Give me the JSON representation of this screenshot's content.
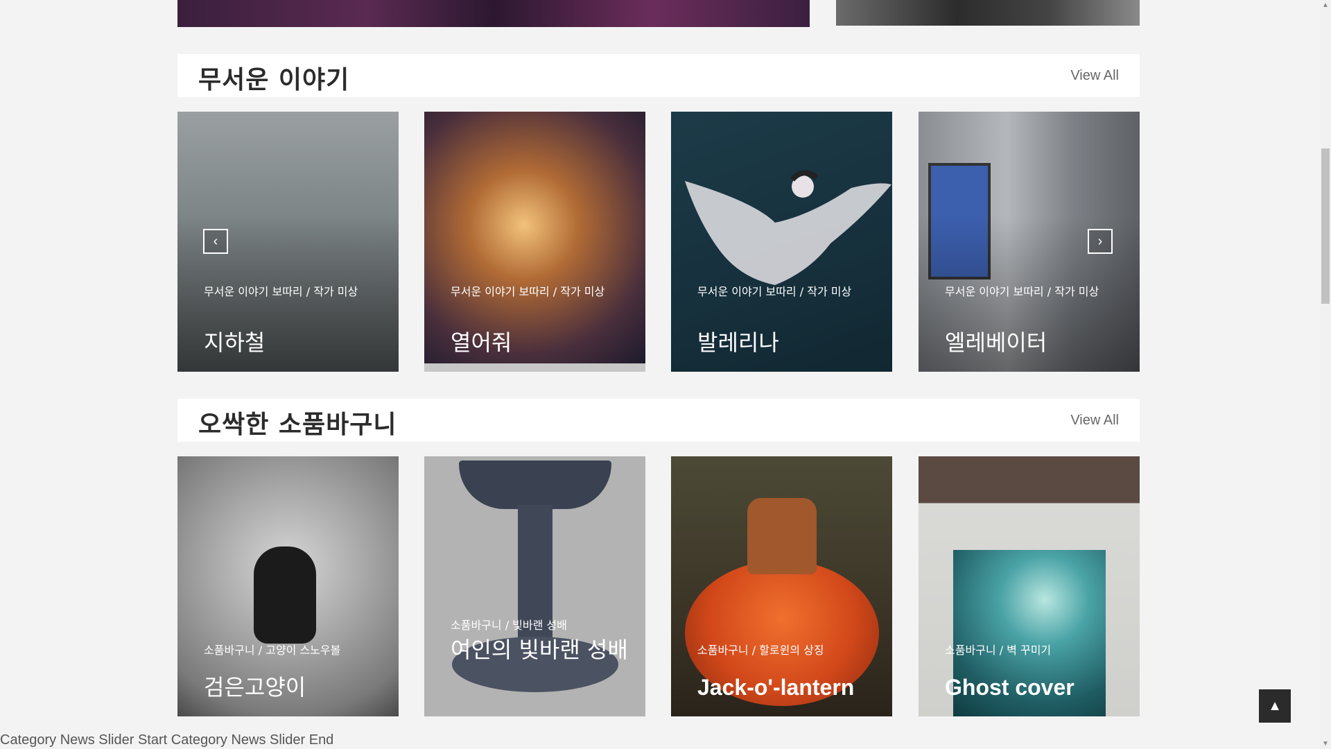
{
  "sections": [
    {
      "title": "무서운 이야기",
      "view_all": "View All",
      "cards": [
        {
          "category": "무서운 이야기 보따리",
          "author": "작가 미상",
          "title": "지하철",
          "bg": "#6d7274"
        },
        {
          "category": "무서운 이야기 보따리",
          "author": "작가 미상",
          "title": "열어줘",
          "bg": "#7a4a2c"
        },
        {
          "category": "무서운 이야기 보따리",
          "author": "작가 미상",
          "title": "발레리나",
          "bg": "#1f3a45"
        },
        {
          "category": "무서운 이야기 보따리",
          "author": "작가 미상",
          "title": "엘레베이터",
          "bg": "#6f7277"
        }
      ]
    },
    {
      "title": "오싹한 소품바구니",
      "view_all": "View All",
      "cards": [
        {
          "category": "소품바구니",
          "author": "고양이 스노우볼",
          "title": "검은고양이",
          "bg": "#9b9b9b"
        },
        {
          "category": "소품바구니",
          "author": "빛바랜 성배",
          "title": "여인의 빛바랜 성배",
          "bg": "#a8a8a8"
        },
        {
          "category": "소품바구니",
          "author": "할로윈의 상징",
          "title": "Jack-o'-lantern",
          "bg": "#6b3a1f"
        },
        {
          "category": "소품바구니",
          "author": "벽 꾸미기",
          "title": "Ghost cover",
          "bg": "#3d6e72"
        }
      ]
    }
  ],
  "slider": {
    "prev_icon": "chevron-left-icon",
    "next_icon": "chevron-right-icon"
  },
  "back_to_top_icon": "chevron-up-icon",
  "footer_text": "Category News Slider Start Category News Slider End"
}
